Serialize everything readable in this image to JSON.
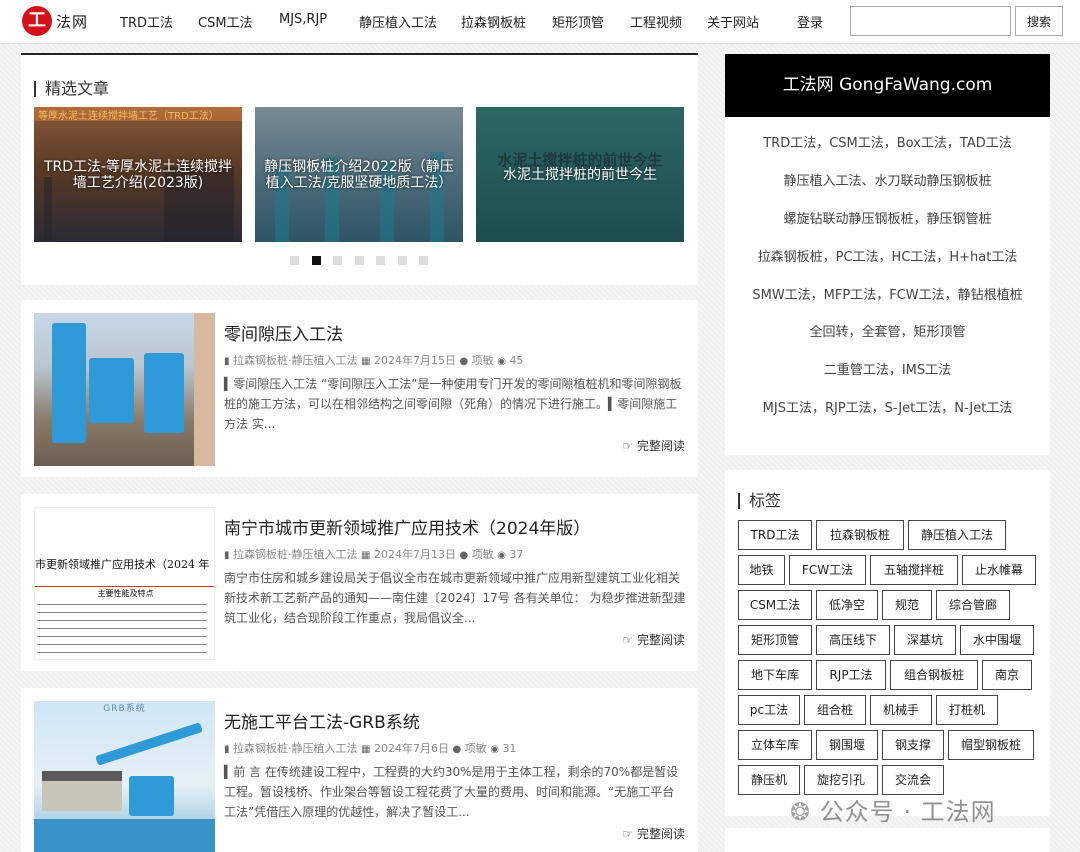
{
  "logo": {
    "mark": "工",
    "text": "法网"
  },
  "nav": {
    "items": [
      "TRD工法",
      "CSM工法",
      "MJS,RJP",
      "静压植入工法",
      "拉森钢板桩",
      "矩形顶管",
      "工程视频",
      "关于网站"
    ],
    "login": "登录"
  },
  "search": {
    "value": "",
    "placeholder": "",
    "button": "搜索"
  },
  "featured": {
    "title": "精选文章",
    "slides": [
      {
        "caption": "TRD工法-等厚水泥土连续搅拌墙工艺介绍(2023版)",
        "image_text": "等厚水泥土连续搅拌墙工艺（TRD工法）"
      },
      {
        "caption": "静压钢板桩介绍2022版（静压植入工法/克服坚硬地质工法）"
      },
      {
        "caption": "水泥土搅拌桩的前世今生",
        "image_text": "水泥土搅拌桩的前世今生"
      }
    ],
    "dots_active_index": 1,
    "dots_count": 7
  },
  "articles": [
    {
      "title": "零间隙压入工法",
      "category": "拉森钢板桩·静压植入工法",
      "date": "2024年7月15日",
      "author": "项敏",
      "views": "45",
      "excerpt": "▍零间隙压入工法 “零间隙压入工法”是一种使用专门开发的零间隙植桩机和零间隙钢板桩的施工方法，可以在相邻结构之间零间隙（死角）的情况下进行施工。▍零间隙施工方法 实...",
      "read_more": "完整阅读"
    },
    {
      "title": "南宁市城市更新领域推广应用技术（2024年版）",
      "category": "拉森钢板桩·静压植入工法",
      "date": "2024年7月13日",
      "author": "项敏",
      "views": "37",
      "excerpt": "南宁市住房和城乡建设局关于倡议全市在城市更新领域中推广应用新型建筑工业化相关新技术新工艺新产品的通知——南住建〔2024〕17号 各有关单位： 为稳步推进新型建筑工业化，结合现阶段工作重点，我局倡议全...",
      "read_more": "完整阅读",
      "thumb_heading": "市更新领域推广应用技术（2024 年",
      "thumb_table_head": "主要性能及特点"
    },
    {
      "title": "无施工平台工法-GRB系统",
      "category": "拉森钢板桩·静压植入工法",
      "date": "2024年7月6日",
      "author": "项敏",
      "views": "31",
      "excerpt": "▍前 言 在传统建设工程中，工程费的大约30%是用于主体工程，剩余的70%都是暂设工程。暂设栈桥、作业架台等暂设工程花费了大量的费用、时间和能源。“无施工平台工法”凭借压入原理的优越性，解决了暂设工...",
      "read_more": "完整阅读",
      "thumb_label": "GRB系统"
    }
  ],
  "sidebar": {
    "title": "工法网 GongFaWang.com",
    "links": [
      "TRD工法，CSM工法，Box工法，TAD工法",
      "静压植入工法、水刀联动静压钢板桩",
      "螺旋钻联动静压钢板桩，静压钢管桩",
      "拉森钢板桩，PC工法，HC工法，H+hat工法",
      "SMW工法，MFP工法，FCW工法，静钻根植桩",
      "全回转，全套管，矩形顶管",
      "二重管工法，IMS工法",
      "MJS工法，RJP工法，S-Jet工法，N-Jet工法"
    ]
  },
  "tags": {
    "title": "标签",
    "items": [
      "TRD工法",
      "拉森钢板桩",
      "静压植入工法",
      "地铁",
      "FCW工法",
      "五轴搅拌桩",
      "止水帷幕",
      "CSM工法",
      "低净空",
      "规范",
      "综合管廊",
      "矩形顶管",
      "高压线下",
      "深基坑",
      "水中围堰",
      "地下车库",
      "RJP工法",
      "组合钢板桩",
      "南京",
      "pc工法",
      "组合桩",
      "机械手",
      "打桩机",
      "立体车库",
      "钢围堰",
      "钢支撑",
      "帽型钢板桩",
      "静压机",
      "旋挖引孔",
      "交流会"
    ]
  },
  "watermark": {
    "text": "公众号 · 工法网"
  },
  "icons": {
    "category": "bookmark-icon",
    "date": "calendar-icon",
    "author": "user-icon",
    "views": "eye-icon",
    "read": "hand-point-icon",
    "watermark": "wechat-icon"
  }
}
